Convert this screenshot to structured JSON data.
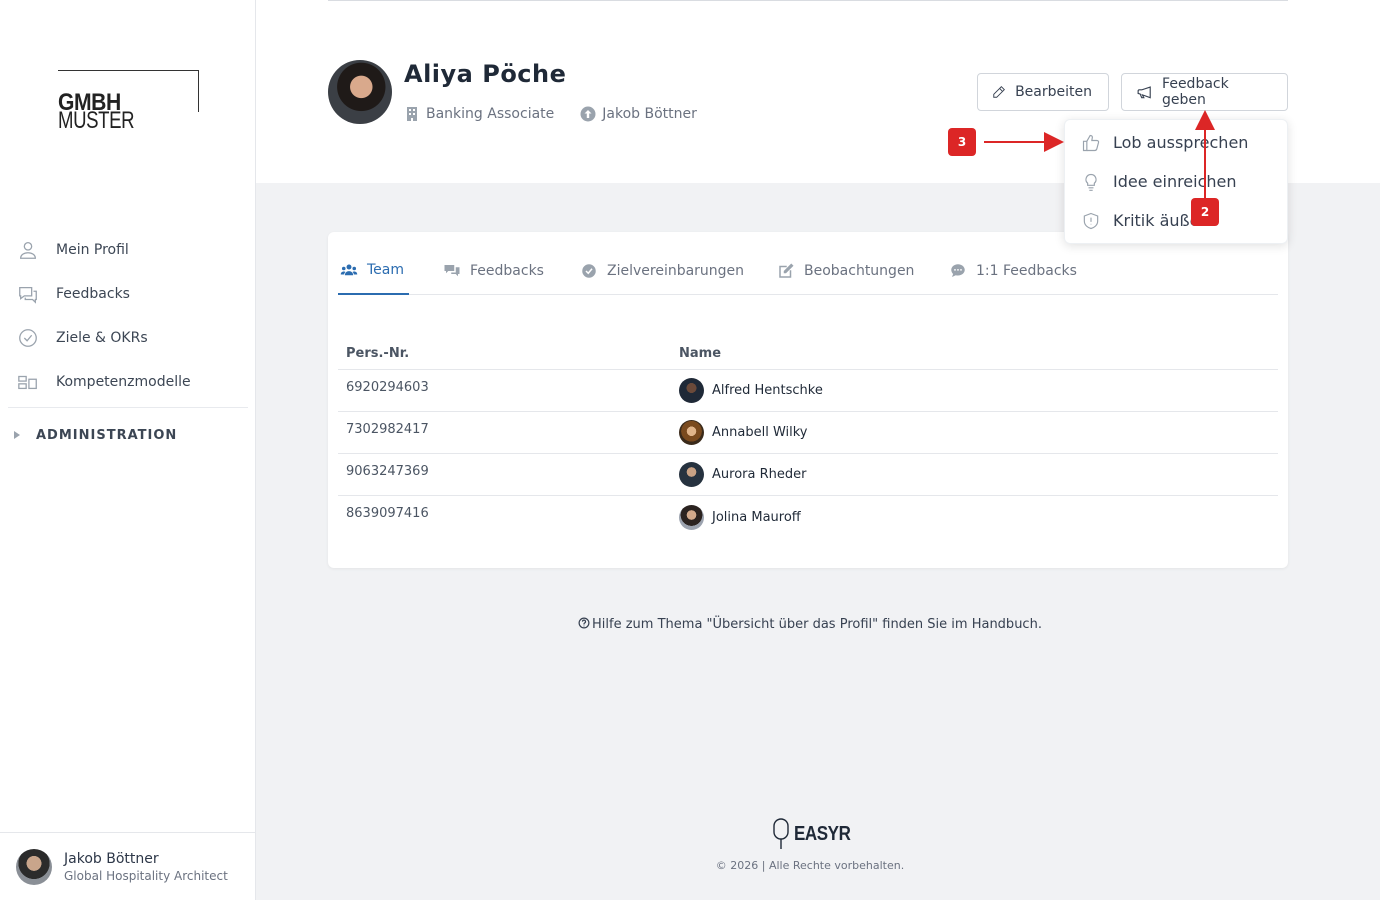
{
  "brand": {
    "logo_regular": "MUSTER",
    "logo_bold": "GMBH"
  },
  "sidebar": {
    "items": [
      {
        "label": "Mein Profil",
        "icon": "user-icon"
      },
      {
        "label": "Feedbacks",
        "icon": "chat-icon"
      },
      {
        "label": "Ziele & OKRs",
        "icon": "check-circle-icon"
      },
      {
        "label": "Kompetenzmodelle",
        "icon": "grid-icon"
      }
    ],
    "admin_label": "ADMINISTRATION"
  },
  "current_user": {
    "name": "Jakob Böttner",
    "role": "Global Hospitality Architect"
  },
  "profile": {
    "name": "Aliya Pöche",
    "position": "Banking Associate",
    "manager": "Jakob Böttner"
  },
  "actions": {
    "edit_label": "Bearbeiten",
    "feedback_label": "Feedback geben"
  },
  "dropdown": {
    "items": [
      {
        "label": "Lob aussprechen",
        "icon": "thumbs-up-icon"
      },
      {
        "label": "Idee einreichen",
        "icon": "lightbulb-icon"
      },
      {
        "label": "Kritik äußern",
        "icon": "shield-icon"
      }
    ]
  },
  "tabs": [
    {
      "label": "Team",
      "icon": "users-icon",
      "active": true
    },
    {
      "label": "Feedbacks",
      "icon": "comments-icon"
    },
    {
      "label": "Zielvereinbarungen",
      "icon": "check-circle-icon"
    },
    {
      "label": "Beobachtungen",
      "icon": "edit-icon"
    },
    {
      "label": "1:1 Feedbacks",
      "icon": "comment-dots-icon"
    }
  ],
  "table": {
    "headers": [
      "Pers.-Nr.",
      "Name"
    ],
    "rows": [
      {
        "id": "6920294603",
        "name": "Alfred Hentschke"
      },
      {
        "id": "7302982417",
        "name": "Annabell Wilky"
      },
      {
        "id": "9063247369",
        "name": "Aurora Rheder"
      },
      {
        "id": "8639097416",
        "name": "Jolina Mauroff"
      }
    ]
  },
  "help_text": "Hilfe zum Thema \"Übersicht über das Profil\" finden Sie im Handbuch.",
  "footer": {
    "logo": "EASYR",
    "copyright": "© 2026 | Alle Rechte vorbehalten."
  },
  "annotations": {
    "badge_2": "2",
    "badge_3": "3"
  },
  "colors": {
    "accent": "#2b6cb0",
    "annotation": "#dc2626"
  }
}
